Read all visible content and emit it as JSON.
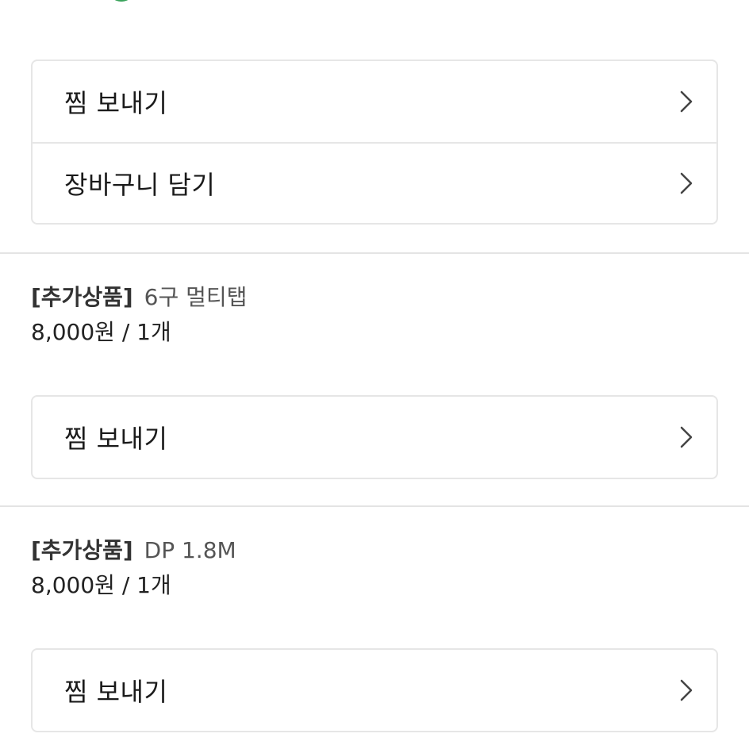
{
  "actions_top": [
    {
      "label": "찜 보내기"
    },
    {
      "label": "장바구니 담기"
    }
  ],
  "addons": [
    {
      "tag": "[추가상품]",
      "name": "6구 멀티탭",
      "price": "8,000원 / 1개",
      "action_label": "찜 보내기"
    },
    {
      "tag": "[추가상품]",
      "name": "DP 1.8M",
      "price": "8,000원 / 1개",
      "action_label": "찜 보내기"
    }
  ],
  "colors": {
    "border": "#e6e6e6",
    "text": "#1a1a1a",
    "muted": "#555555",
    "logo_green": "#3aa35c"
  },
  "icons": [
    "chevron-right-icon",
    "logo-icon"
  ]
}
